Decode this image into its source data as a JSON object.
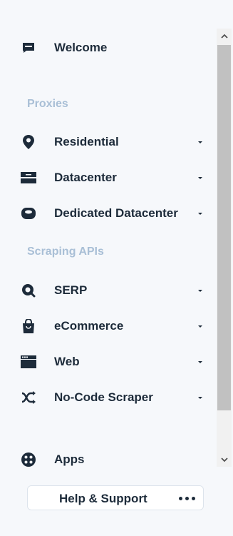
{
  "menu": {
    "welcome": {
      "label": "Welcome",
      "icon": "chat-message-icon"
    },
    "proxies_heading": "Proxies",
    "proxies": [
      {
        "label": "Residential",
        "icon": "map-pin-icon"
      },
      {
        "label": "Datacenter",
        "icon": "server-icon"
      },
      {
        "label": "Dedicated Datacenter",
        "icon": "database-icon"
      }
    ],
    "scraping_heading": "Scraping APIs",
    "scraping": [
      {
        "label": "SERP",
        "icon": "search-icon"
      },
      {
        "label": "eCommerce",
        "icon": "shopping-bag-icon"
      },
      {
        "label": "Web",
        "icon": "browser-window-icon"
      },
      {
        "label": "No-Code Scraper",
        "icon": "shuffle-icon"
      }
    ],
    "apps": {
      "label": "Apps",
      "icon": "apps-grid-icon"
    }
  },
  "help": {
    "label": "Help & Support",
    "icon": "more-dots-icon"
  },
  "colors": {
    "text": "#1d2b3a",
    "heading": "#a9bfd6",
    "background": "#f6f8fb"
  }
}
